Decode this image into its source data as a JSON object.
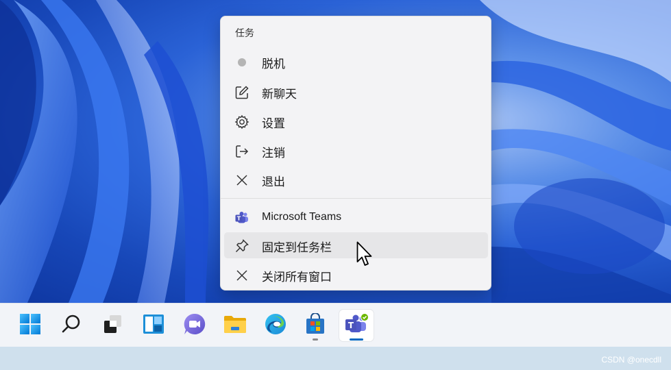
{
  "menu": {
    "header": "任务",
    "items": [
      {
        "label": "脱机",
        "icon": "status-dot-icon"
      },
      {
        "label": "新聊天",
        "icon": "compose-icon"
      },
      {
        "label": "设置",
        "icon": "gear-icon"
      },
      {
        "label": "注销",
        "icon": "sign-out-icon"
      },
      {
        "label": "退出",
        "icon": "close-icon"
      },
      {
        "label": "Microsoft Teams",
        "icon": "teams-icon"
      },
      {
        "label": "固定到任务栏",
        "icon": "pin-icon"
      },
      {
        "label": "关闭所有窗口",
        "icon": "close-icon"
      }
    ]
  },
  "taskbar": {
    "apps": [
      {
        "name": "start",
        "icon": "windows-logo-icon"
      },
      {
        "name": "search",
        "icon": "search-icon"
      },
      {
        "name": "task-view",
        "icon": "task-view-icon"
      },
      {
        "name": "widgets",
        "icon": "widgets-icon"
      },
      {
        "name": "chat",
        "icon": "chat-icon"
      },
      {
        "name": "file-explorer",
        "icon": "folder-icon"
      },
      {
        "name": "edge",
        "icon": "edge-icon"
      },
      {
        "name": "store",
        "icon": "store-icon"
      },
      {
        "name": "teams",
        "icon": "teams-icon"
      }
    ]
  },
  "watermark": "CSDN @onecdll",
  "colors": {
    "accent": "#0067c0",
    "teams": "#5b5fc7",
    "status_offline": "#b4b4b4"
  }
}
